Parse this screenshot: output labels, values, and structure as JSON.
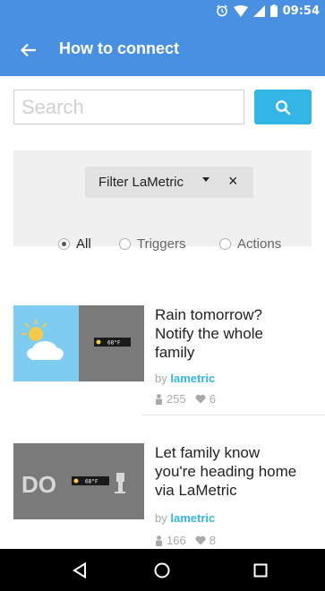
{
  "status_bar": {
    "time": "09:54",
    "icons": [
      "alarm-icon",
      "wifi-icon",
      "cellular-signal-icon",
      "battery-icon"
    ]
  },
  "app_bar": {
    "title": "How to connect",
    "back_icon": "arrow-left-icon"
  },
  "search": {
    "placeholder": "Search",
    "value": "",
    "button_icon": "search-icon"
  },
  "filter": {
    "label": "Filter LaMetric",
    "clear_icon": "close-icon",
    "options": [
      {
        "label": "All",
        "selected": true
      },
      {
        "label": "Triggers",
        "selected": false
      },
      {
        "label": "Actions",
        "selected": false
      }
    ]
  },
  "recipes": [
    {
      "title_lines": [
        "Rain tomorrow?",
        "Notify the whole",
        "family"
      ],
      "by": "by",
      "author": "lametric",
      "users": "255",
      "favorites": "6",
      "device_text": "68°F"
    },
    {
      "title_lines": [
        "Let family know",
        "you're heading home",
        "via LaMetric"
      ],
      "by": "by",
      "author": "lametric",
      "users": "166",
      "favorites": "8",
      "badge_text": "DO",
      "device_text": "68°F"
    }
  ],
  "colors": {
    "primary": "#4a90e2",
    "accent": "#33b5e5",
    "filter_bg": "#f0f0f0",
    "sky": "#7ecdf0",
    "tile_grey": "#7a7a7a"
  },
  "nav_bar": {
    "icons": [
      "back-triangle-icon",
      "home-circle-icon",
      "recents-square-icon"
    ]
  }
}
